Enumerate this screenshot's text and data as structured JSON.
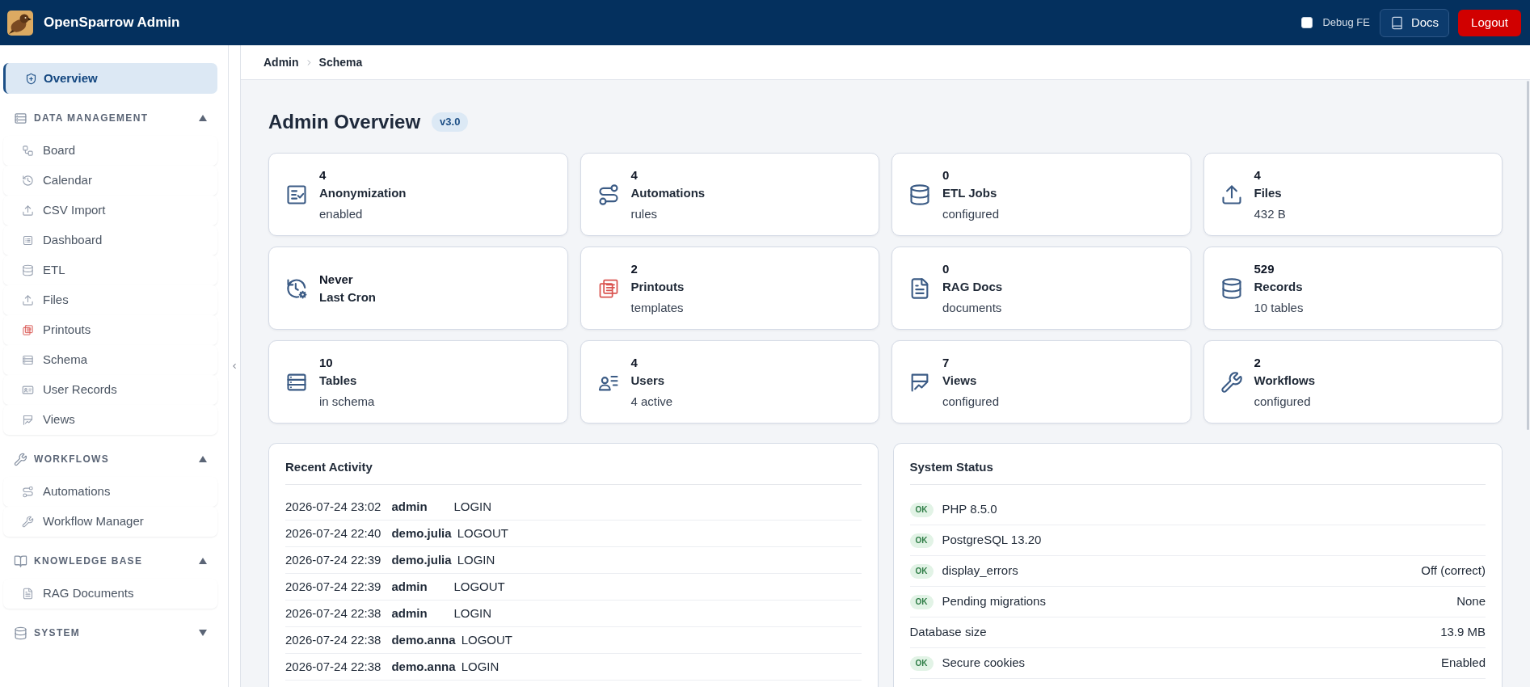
{
  "header": {
    "title": "OpenSparrow Admin",
    "debug": {
      "label": "Debug FE",
      "checked": false
    },
    "docs_button": "Docs",
    "logout_button": "Logout"
  },
  "sidebar": {
    "items": [
      {
        "label": "Overview",
        "selected": true
      }
    ],
    "sections": [
      {
        "title": "DATA MANAGEMENT",
        "expanded": true,
        "items": [
          {
            "label": "Board",
            "selected": false
          },
          {
            "label": "Calendar",
            "selected": false
          },
          {
            "label": "CSV Import",
            "selected": false
          },
          {
            "label": "Dashboard",
            "selected": false
          },
          {
            "label": "ETL",
            "selected": false
          },
          {
            "label": "Files",
            "selected": false
          },
          {
            "label": "Printouts",
            "selected": false
          },
          {
            "label": "Schema",
            "selected": false
          },
          {
            "label": "User Records",
            "selected": false
          },
          {
            "label": "Views",
            "selected": false
          }
        ]
      },
      {
        "title": "WORKFLOWS",
        "expanded": true,
        "items": [
          {
            "label": "Automations",
            "selected": false
          },
          {
            "label": "Workflow Manager",
            "selected": false
          }
        ]
      },
      {
        "title": "KNOWLEDGE BASE",
        "expanded": true,
        "items": [
          {
            "label": "RAG Documents",
            "selected": false
          }
        ]
      },
      {
        "title": "SYSTEM",
        "expanded": false
      }
    ]
  },
  "breadcrumb": [
    {
      "label": "Admin"
    },
    {
      "label": "Schema"
    }
  ],
  "page": {
    "title": "Admin Overview",
    "version": "v3.0"
  },
  "stats": [
    {
      "value": "4",
      "label": "Anonymization",
      "detail": "enabled"
    },
    {
      "value": "4",
      "label": "Automations",
      "detail": "rules"
    },
    {
      "value": "0",
      "label": "ETL Jobs",
      "detail": "configured"
    },
    {
      "value": "4",
      "label": "Files",
      "detail": "432 B"
    },
    {
      "value": "Never",
      "label": "Last Cron"
    },
    {
      "value": "2",
      "label": "Printouts",
      "detail": "templates"
    },
    {
      "value": "0",
      "label": "RAG Docs",
      "detail": "documents"
    },
    {
      "value": "529",
      "label": "Records",
      "detail": "10 tables"
    },
    {
      "value": "10",
      "label": "Tables",
      "detail": "in schema"
    },
    {
      "value": "4",
      "label": "Users",
      "detail": "4 active"
    },
    {
      "value": "7",
      "label": "Views",
      "detail": "configured"
    },
    {
      "value": "2",
      "label": "Workflows",
      "detail": "configured"
    }
  ],
  "recent_activity": {
    "title": "Recent Activity",
    "rows": [
      {
        "time": "2026-07-24 23:02",
        "user": "admin",
        "action": "LOGIN"
      },
      {
        "time": "2026-07-24 22:40",
        "user": "demo.julia",
        "action": "LOGOUT"
      },
      {
        "time": "2026-07-24 22:39",
        "user": "demo.julia",
        "action": "LOGIN"
      },
      {
        "time": "2026-07-24 22:39",
        "user": "admin",
        "action": "LOGOUT"
      },
      {
        "time": "2026-07-24 22:38",
        "user": "admin",
        "action": "LOGIN"
      },
      {
        "time": "2026-07-24 22:38",
        "user": "demo.anna",
        "action": "LOGOUT"
      },
      {
        "time": "2026-07-24 22:38",
        "user": "demo.anna",
        "action": "LOGIN"
      }
    ]
  },
  "system_status": {
    "title": "System Status",
    "rows": [
      {
        "badge": "OK",
        "label": "PHP 8.5.0"
      },
      {
        "badge": "OK",
        "label": "PostgreSQL 13.20"
      },
      {
        "badge": "OK",
        "label": "display_errors",
        "value": "Off (correct)"
      },
      {
        "badge": "OK",
        "label": "Pending migrations",
        "value": "None"
      },
      {
        "label": "Database size",
        "value": "13.9 MB"
      },
      {
        "badge": "OK",
        "label": "Secure cookies",
        "value": "Enabled"
      }
    ]
  }
}
